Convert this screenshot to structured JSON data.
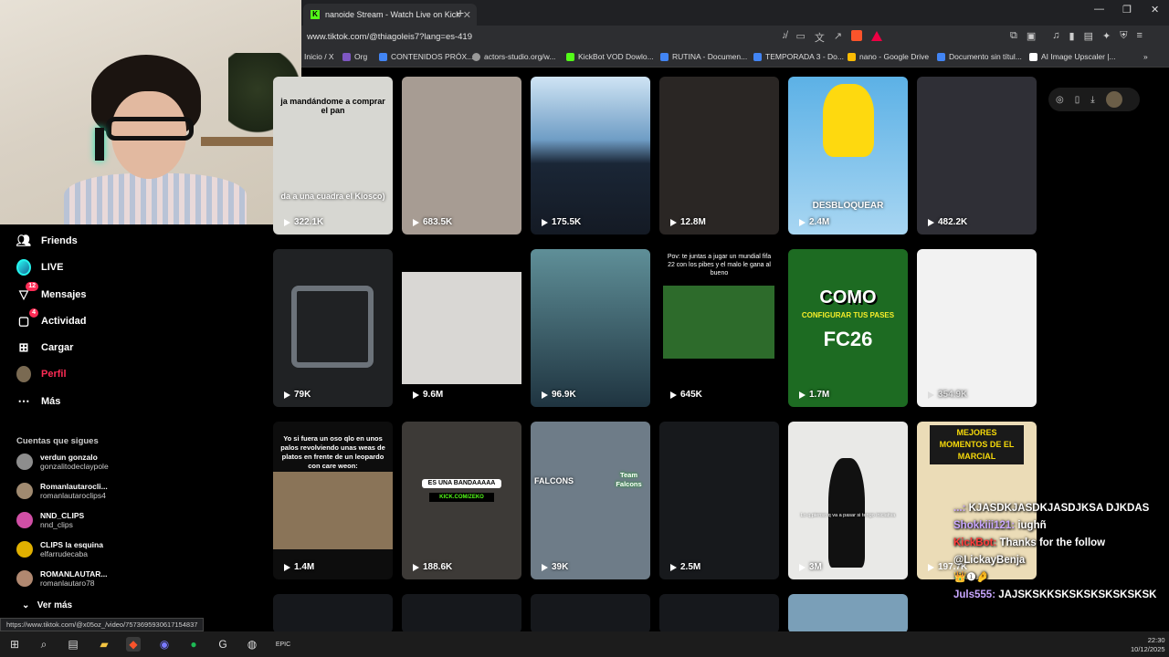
{
  "browser": {
    "tab_title": "nanoide Stream - Watch Live on Kick",
    "url": "www.tiktok.com/@thiagoleis7?lang=es-419",
    "status_url": "https://www.tiktok.com/@x05oz_/video/7573695930617154837",
    "bookmarks": [
      {
        "label": "Inicio / X",
        "color": "#000000"
      },
      {
        "label": "Org",
        "color": "#7e57c2"
      },
      {
        "label": "CONTENIDOS PRÓX...",
        "color": "#4285f4"
      },
      {
        "label": "actors-studio.org/w...",
        "color": "#999999"
      },
      {
        "label": "KickBot VOD Dowlo...",
        "color": "#53fc18"
      },
      {
        "label": "RUTINA - Documen...",
        "color": "#4285f4"
      },
      {
        "label": "TEMPORADA 3 - Do...",
        "color": "#4285f4"
      },
      {
        "label": "nano - Google Drive",
        "color": "#fbbc04"
      },
      {
        "label": "Documento sin títul...",
        "color": "#4285f4"
      },
      {
        "label": "AI Image Upscaler |...",
        "color": "#ffffff"
      }
    ]
  },
  "nav": {
    "items": [
      {
        "label": "Friends",
        "icon": "friends-icon"
      },
      {
        "label": "LIVE",
        "icon": "live-icon"
      },
      {
        "label": "Mensajes",
        "icon": "messages-icon",
        "badge": "12"
      },
      {
        "label": "Actividad",
        "icon": "activity-icon",
        "badge": "4"
      },
      {
        "label": "Cargar",
        "icon": "upload-icon"
      },
      {
        "label": "Perfil",
        "icon": "profile-icon"
      },
      {
        "label": "Más",
        "icon": "more-icon"
      }
    ],
    "following_title": "Cuentas que sigues",
    "following": [
      {
        "name": "verdun gonzalo",
        "handle": "gonzalitodeclaypole",
        "color": "#8d8d8d"
      },
      {
        "name": "Romanlautarocli...",
        "handle": "romanlautaroclips4",
        "color": "#a08a70"
      },
      {
        "name": "NND_CLIPS",
        "handle": "nnd_clips",
        "color": "#d04fa5"
      },
      {
        "name": "CLIPS la esquina",
        "handle": "elfarrudecaba",
        "color": "#e0b000"
      },
      {
        "name": "ROMANLAUTAR...",
        "handle": "romanlautaro78",
        "color": "#b08870"
      }
    ],
    "see_more": "Ver más"
  },
  "videos": [
    {
      "views": "322.1K",
      "caption_top": "ja mandándome a comprar el pan",
      "caption_bottom": "da a una cuadra el Kiosco)",
      "bg": "#d7d7d2"
    },
    {
      "views": "683.5K",
      "bg": "#a79c93"
    },
    {
      "views": "175.5K",
      "bg": "#24344a"
    },
    {
      "views": "12.8M",
      "bg": "#2a2624"
    },
    {
      "views": "2.4M",
      "caption_bottom": "DESBLOQUEAR",
      "bg": "#5cb1e6"
    },
    {
      "views": "482.2K",
      "bg": "#2f2f36"
    },
    {
      "views": "79K",
      "bg": "#202224"
    },
    {
      "views": "9.6M",
      "bg": "#d9d7d4"
    },
    {
      "views": "96.9K",
      "bg": "#3d5f68"
    },
    {
      "views": "645K",
      "caption_top": "Pov: te juntas a jugar un mundial fifa 22 con los pibes y el malo le gana al bueno",
      "bg": "#2d6b2b"
    },
    {
      "views": "1.7M",
      "caption_top": "COMO",
      "caption_mid": "CONFIGURAR TUS PASES",
      "caption_bottom": "FC26",
      "bg": "#1d6b22"
    },
    {
      "views": "354.9K",
      "bg": "#f2f2f2"
    },
    {
      "views": "1.4M",
      "caption_top": "Yo si fuera un oso qlo en unos palos revolviendo unas weas de platos en frente de un leopardo con care weon:",
      "bg": "#0d0d0d"
    },
    {
      "views": "188.6K",
      "caption_mid": "ES UNA BANDAAAAA",
      "caption_bottom": "KICK.COM/ZEKO",
      "bg": "#3d3a37"
    },
    {
      "views": "39K",
      "caption_mid": "FALCONS",
      "caption_bottom": "Team Falcons",
      "bg": "#6e7c88"
    },
    {
      "views": "2.5M",
      "bg": "#17191c"
    },
    {
      "views": "3M",
      "caption_mid": "Lo q pienso q va a pasar si tengo iniciativa",
      "bg": "#e9e9e7"
    },
    {
      "views": "197.7K",
      "caption_top": "MEJORES MOMENTOS DE EL MARCIAL",
      "bg": "#ebdcb7"
    }
  ],
  "chat": [
    {
      "user": "...:",
      "text": "KJASDKJASDKJASDJKSA DJKDAS",
      "user_color": "#c9a7ff"
    },
    {
      "user": "Shokkiii121:",
      "text": "iughñ",
      "user_color": "#c9a7ff"
    },
    {
      "user": "KickBot:",
      "text": "Thanks for the follow @LickayBenja",
      "user_color": "#ff3b3b"
    },
    {
      "user": "Juls555:",
      "text": "JAJSKSKKSKSKSKSKSKSKSK",
      "user_color": "#c9a7ff",
      "prefix": "👑❶🤌"
    }
  ],
  "taskbar": {
    "time": "22:30",
    "date": "10/12/2025"
  }
}
